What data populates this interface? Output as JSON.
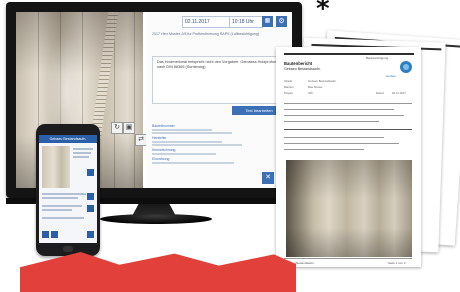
{
  "asterisk": "*",
  "monitor": {
    "date": "02.11.2017",
    "time": "10:18 Uhr",
    "meta_text": "2017 Herr Muster, AS fur Prufbestimmung RAPS (Luftbesichtigung)",
    "note_text": "Das Holzmerkmal entspricht nicht den Vorgaben. Gemaess Holzprufung nach DIN 68365 (Sortierung)",
    "edit_label": "Text bearbeiten",
    "sections": [
      {
        "label": "Bauteilnummer"
      },
      {
        "label": "Hersteller"
      },
      {
        "label": "Kennzeichnung"
      },
      {
        "label": "Einordnung"
      }
    ],
    "colors": {
      "accent": "#3b6fb6",
      "bezel": "#141414"
    }
  },
  "phone": {
    "title": "Gebaeu Bestandsaufn."
  },
  "document": {
    "title": "Bautenbericht",
    "subtitle": "Gebaeu Bestandsaufn.",
    "logo_label": "ausbau",
    "header_right": "Baubesichtigung",
    "rows": [
      {
        "label": "Objekt",
        "value": "Gebaeu Bestandsaufn."
      },
      {
        "label": "Bauherr",
        "value": "Max Muster"
      },
      {
        "label": "Projekt",
        "value": "345"
      },
      {
        "label": "Datum",
        "value": "02.11.2017"
      }
    ],
    "footer_left": "Gebaeu Bestandsaufn.",
    "footer_right": "Seite 1 von 3"
  },
  "banner_color": "#e2403a"
}
